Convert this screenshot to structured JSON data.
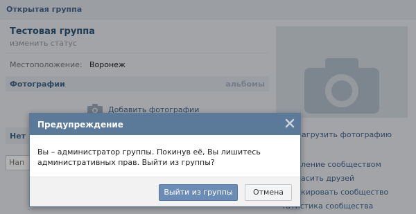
{
  "header": {
    "title": "Открытая группа"
  },
  "group": {
    "name": "Тестовая группа",
    "status_link": "изменить статус",
    "location_label": "Местоположение:",
    "location_value": "Воронеж"
  },
  "photos": {
    "title": "Фотографии",
    "albums_link": "альбомы",
    "add_label": "Добавить фотографии"
  },
  "nets": {
    "title_fragment": "Нет",
    "input_fragment": "Нап"
  },
  "sidebar": {
    "upload_label": "Загрузить фотографию",
    "menu": [
      "ление сообществом",
      "асить друзей",
      "кировать сообщество",
      "татистика сообщества"
    ]
  },
  "modal": {
    "title": "Предупреждение",
    "message": "Вы – администратор группы. Покинув её, Вы лишитесь административных прав. Выйти из группы?",
    "confirm_label": "Выйти из группы",
    "cancel_label": "Отмена"
  },
  "icons": {
    "camera": "camera-icon",
    "close": "close-icon"
  },
  "colors": {
    "accent": "#45688e",
    "modal_header": "#5b7a99",
    "primary_button": "#6b8db5"
  }
}
